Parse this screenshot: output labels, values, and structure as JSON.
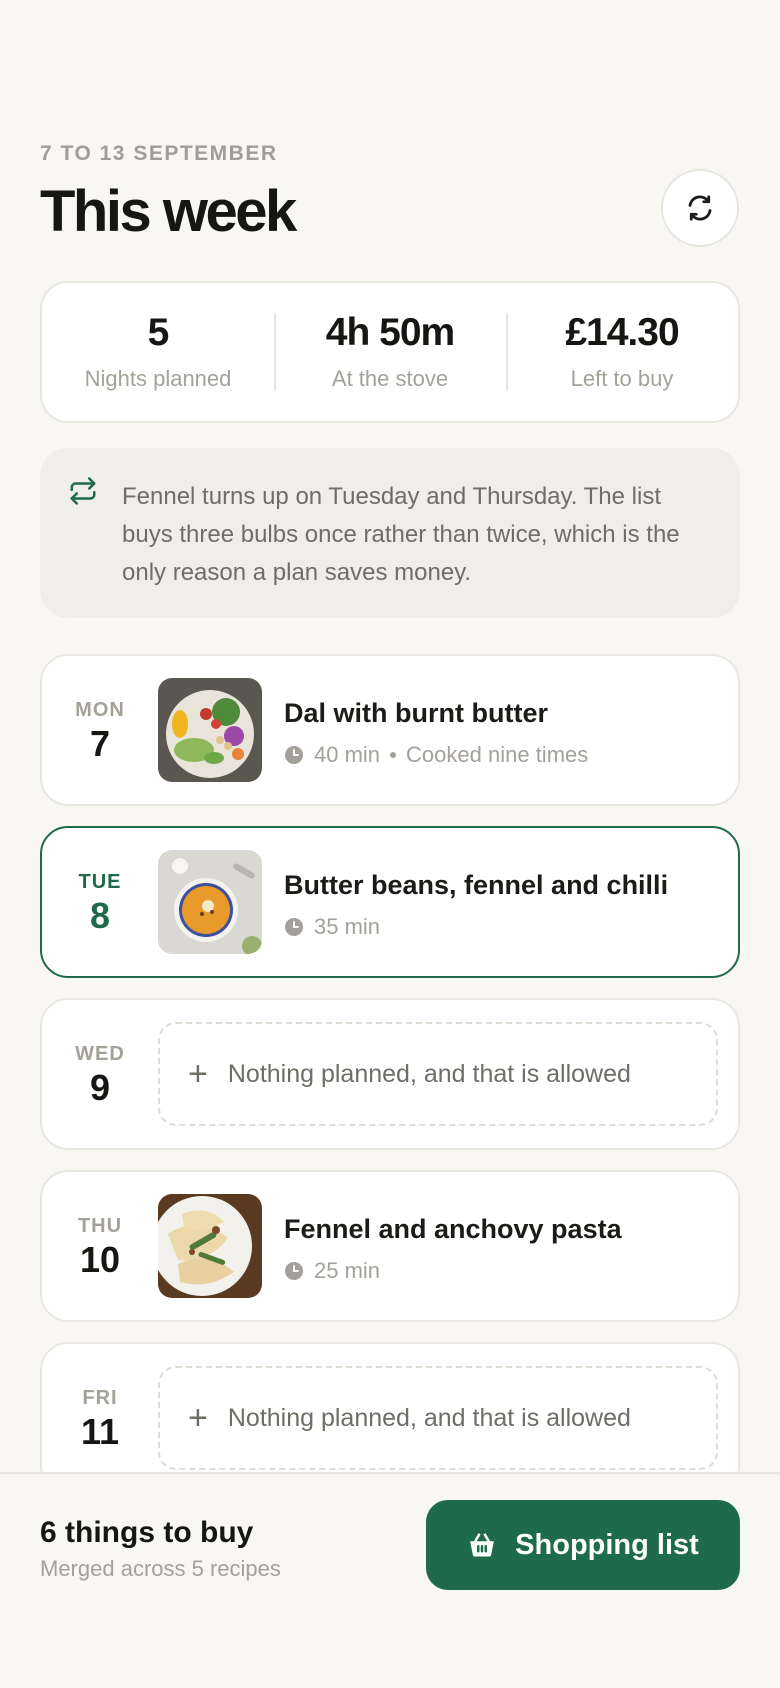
{
  "header": {
    "date_range": "7 TO 13 SEPTEMBER",
    "title": "This week",
    "refresh_icon": "refresh-icon"
  },
  "stats": [
    {
      "value": "5",
      "label": "Nights planned"
    },
    {
      "value": "4h 50m",
      "label": "At the stove"
    },
    {
      "value": "£14.30",
      "label": "Left to buy"
    }
  ],
  "note": {
    "icon": "repeat-icon",
    "text": "Fennel turns up on Tuesday and Thursday. The list buys three bulbs once rather than twice, which is the only reason a plan saves money."
  },
  "days": [
    {
      "day": "MON",
      "date": "7",
      "recipe": "Dal with burnt butter",
      "time": "40 min",
      "extra": "Cooked nine times"
    },
    {
      "day": "TUE",
      "date": "8",
      "recipe": "Butter beans, fennel and chilli",
      "time": "35 min",
      "selected": true
    },
    {
      "day": "WED",
      "date": "9",
      "empty": "Nothing planned, and that is allowed",
      "plus": "+"
    },
    {
      "day": "THU",
      "date": "10",
      "recipe": "Fennel and anchovy pasta",
      "time": "25 min"
    },
    {
      "day": "FRI",
      "date": "11",
      "empty": "Nothing planned, and that is allowed",
      "plus": "+"
    }
  ],
  "footer": {
    "count": "6 things to buy",
    "subtitle": "Merged across 5 recipes",
    "button_label": "Shopping list",
    "button_icon": "basket-icon"
  },
  "colors": {
    "accent": "#1e6b4b",
    "background": "#f8f7f4",
    "muted": "#a3a198"
  }
}
